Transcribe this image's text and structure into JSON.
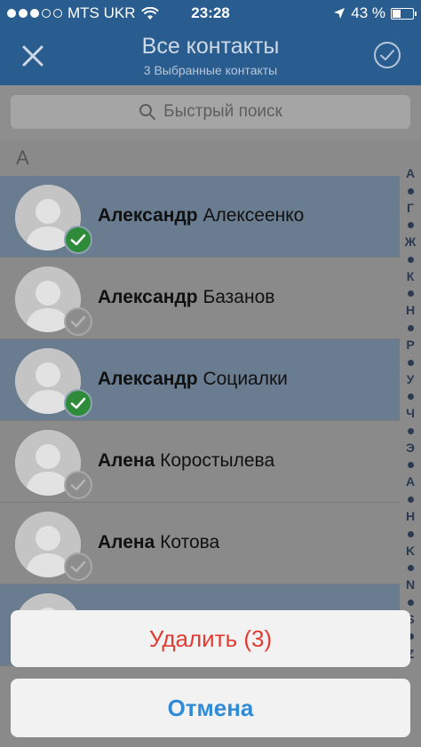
{
  "status_bar": {
    "carrier": "MTS UKR",
    "time": "23:28",
    "battery_text": "43 %",
    "battery_level": 0.43
  },
  "nav": {
    "title": "Все контакты",
    "subtitle": "3 Выбранные контакты",
    "close_icon": "close-icon",
    "confirm_icon": "check-circle-icon"
  },
  "search": {
    "placeholder": "Быстрый поиск",
    "icon": "search-icon"
  },
  "section": {
    "letter": "A"
  },
  "contacts": [
    {
      "first": "Александр",
      "last": "Алексеенко",
      "selected": true
    },
    {
      "first": "Александр",
      "last": "Базанов",
      "selected": false
    },
    {
      "first": "Александр",
      "last": "Социалки",
      "selected": true
    },
    {
      "first": "Алена",
      "last": "Коростылева",
      "selected": false
    },
    {
      "first": "Алена",
      "last": "Котова",
      "selected": false
    },
    {
      "first": "",
      "last": "",
      "selected": true
    }
  ],
  "alphabet_index": [
    "А",
    "•",
    "Г",
    "•",
    "Ж",
    "•",
    "К",
    "•",
    "Н",
    "•",
    "Р",
    "•",
    "У",
    "•",
    "Ч",
    "•",
    "Э",
    "•",
    "A",
    "•",
    "H",
    "•",
    "K",
    "•",
    "N",
    "•",
    "S",
    "•",
    "Z"
  ],
  "action_sheet": {
    "delete_label": "Удалить (3)",
    "cancel_label": "Отмена"
  },
  "colors": {
    "nav_bg": "#2a5d8f",
    "selected_check": "#2e8b3a",
    "delete": "#e03c33",
    "cancel": "#2f8bd6"
  }
}
